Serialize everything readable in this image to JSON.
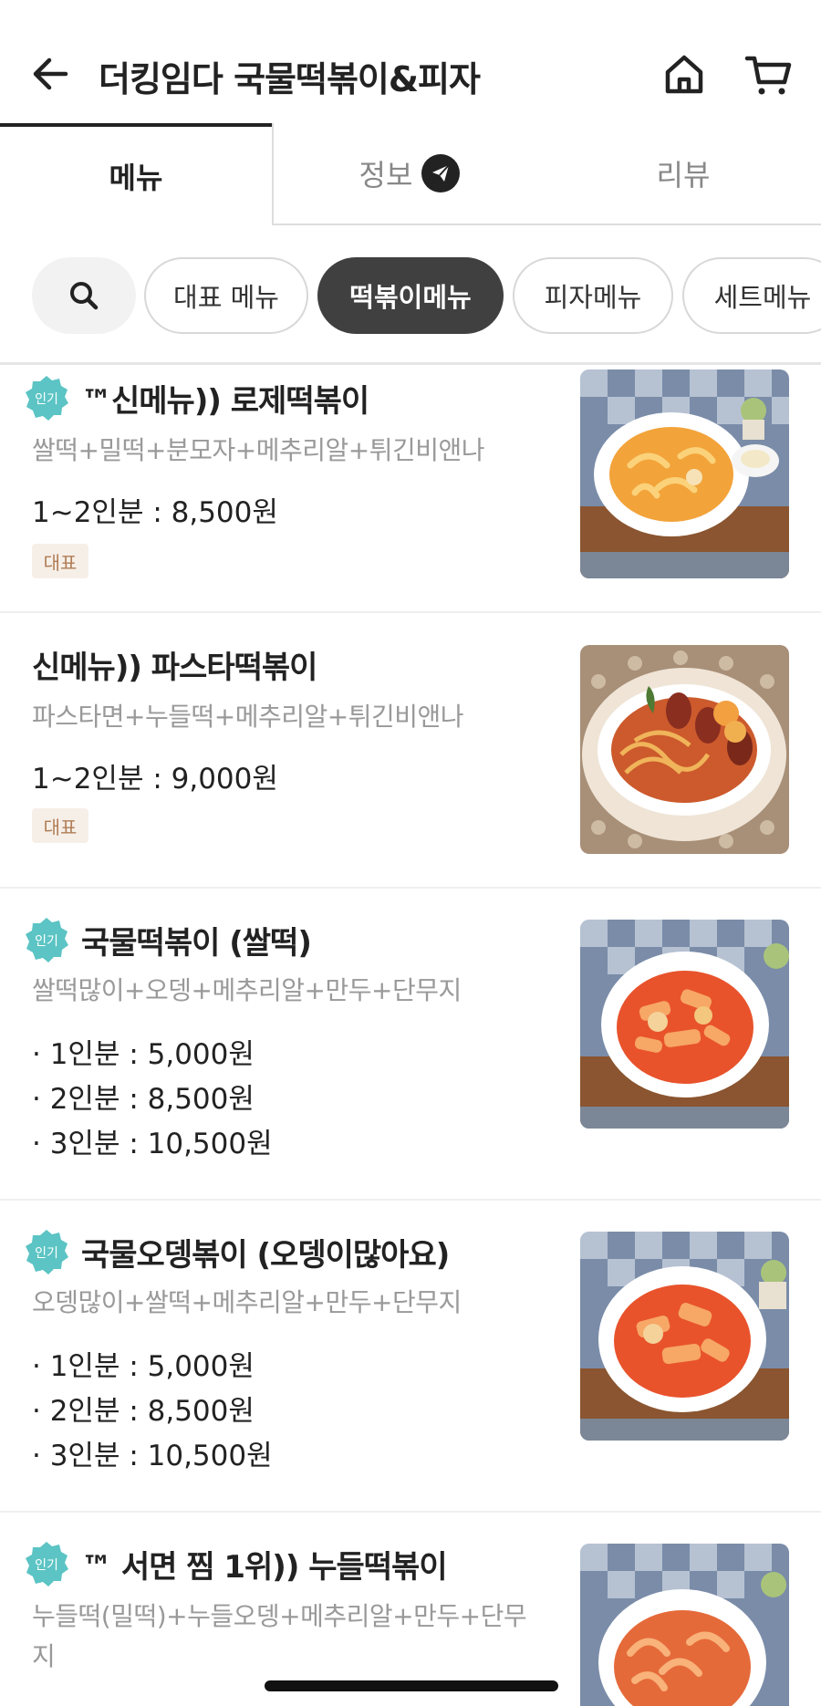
{
  "header": {
    "title": "더킹임다 국물떡볶이&피자",
    "back_icon": "arrow-left-icon",
    "home_icon": "home-icon",
    "cart_icon": "cart-icon"
  },
  "tabs": [
    {
      "label": "메뉴",
      "active": true
    },
    {
      "label": "정보",
      "active": false,
      "icon": "send-badge-icon"
    },
    {
      "label": "리뷰",
      "active": false
    }
  ],
  "categories": {
    "search_icon": "search-icon",
    "items": [
      {
        "label": "대표 메뉴",
        "active": false
      },
      {
        "label": "떡볶이메뉴",
        "active": true
      },
      {
        "label": "피자메뉴",
        "active": false
      },
      {
        "label": "세트메뉴",
        "active": false
      }
    ]
  },
  "menu_items": [
    {
      "popular_badge": "인기",
      "name": "™신메뉴)) 로제떡볶이",
      "desc": "쌀떡+밀떡+분모자+메추리알+튀긴비앤나",
      "prices": [
        "1~2인분 : 8,500원"
      ],
      "tag": "대표"
    },
    {
      "name": "신메뉴)) 파스타떡볶이",
      "desc": "파스타면+누들떡+메추리알+튀긴비앤나",
      "prices": [
        "1~2인분 : 9,000원"
      ],
      "tag": "대표"
    },
    {
      "popular_badge": "인기",
      "name": "국물떡볶이 (쌀떡)",
      "desc": "쌀떡많이+오뎅+메추리알+만두+단무지",
      "prices": [
        "· 1인분 : 5,000원",
        "· 2인분 : 8,500원",
        "· 3인분 : 10,500원"
      ]
    },
    {
      "popular_badge": "인기",
      "name": "국물오뎅볶이 (오뎅이많아요)",
      "desc": "오뎅많이+쌀떡+메추리알+만두+단무지",
      "prices": [
        "· 1인분 : 5,000원",
        "· 2인분 : 8,500원",
        "· 3인분 : 10,500원"
      ]
    },
    {
      "popular_badge": "인기",
      "name": "™ 서면 찜 1위)) 누들떡볶이",
      "desc": "누들떡(밀떡)+누들오뎅+메추리알+만두+단무지"
    }
  ],
  "colors": {
    "active_chip": "#404040",
    "popular_badge": "#5cc4c4",
    "tag_bg": "#f6efe8",
    "tag_text": "#b07d56"
  }
}
